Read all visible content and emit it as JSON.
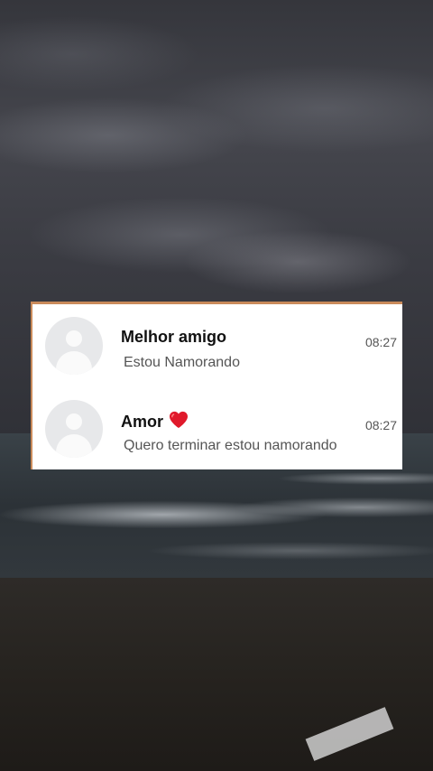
{
  "chats": [
    {
      "name": "Melhor amigo",
      "message": "Estou Namorando",
      "time": "08:27",
      "has_heart": false
    },
    {
      "name": "Amor",
      "message": "Quero terminar estou namorando",
      "time": "08:27",
      "has_heart": true
    }
  ],
  "colors": {
    "card_background": "#ffffff",
    "name_text": "#111111",
    "message_text": "#555555",
    "avatar_placeholder": "#e7e8ea",
    "heart": "#e0192b"
  },
  "icons": {
    "avatar": "default-person-avatar-icon",
    "heart": "red-heart-icon"
  }
}
